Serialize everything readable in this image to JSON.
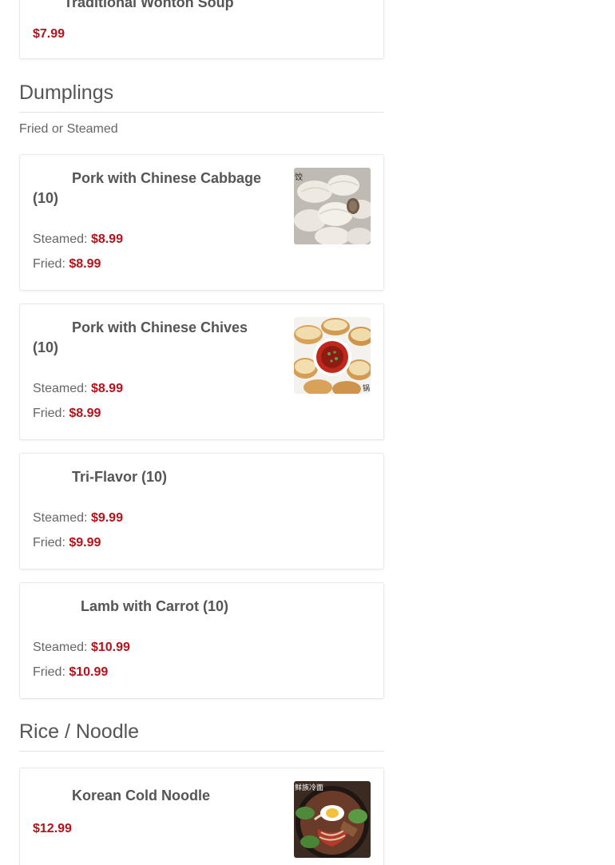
{
  "top_item": {
    "name": "Traditional Wonton Soup",
    "price": "$7.99"
  },
  "sections": {
    "dumplings": {
      "title": "Dumplings",
      "description": "Fried or Steamed",
      "items": [
        {
          "name": "Pork with Chinese Cabbage (10)",
          "steamed_label": "Steamed:",
          "steamed_price": "$8.99",
          "fried_label": "Fried:",
          "fried_price": "$8.99",
          "image_overlay_text": "饺"
        },
        {
          "name": "Pork with Chinese Chives (10)",
          "steamed_label": "Steamed:",
          "steamed_price": "$8.99",
          "fried_label": "Fried:",
          "fried_price": "$8.99",
          "image_overlay_text": "锅"
        },
        {
          "name": "Tri-Flavor (10)",
          "steamed_label": "Steamed:",
          "steamed_price": "$9.99",
          "fried_label": "Fried:",
          "fried_price": "$9.99"
        },
        {
          "name": "Lamb with Carrot (10)",
          "steamed_label": "Steamed:",
          "steamed_price": "$10.99",
          "fried_label": "Fried:",
          "fried_price": "$10.99"
        }
      ]
    },
    "rice_noodle": {
      "title": "Rice / Noodle",
      "items": [
        {
          "name": "Korean Cold Noodle",
          "price": "$12.99",
          "image_overlay_text": "鲜族冷面"
        }
      ]
    }
  },
  "colors": {
    "price": "#b5121b",
    "text": "#555555",
    "border": "#e8e8e8"
  }
}
